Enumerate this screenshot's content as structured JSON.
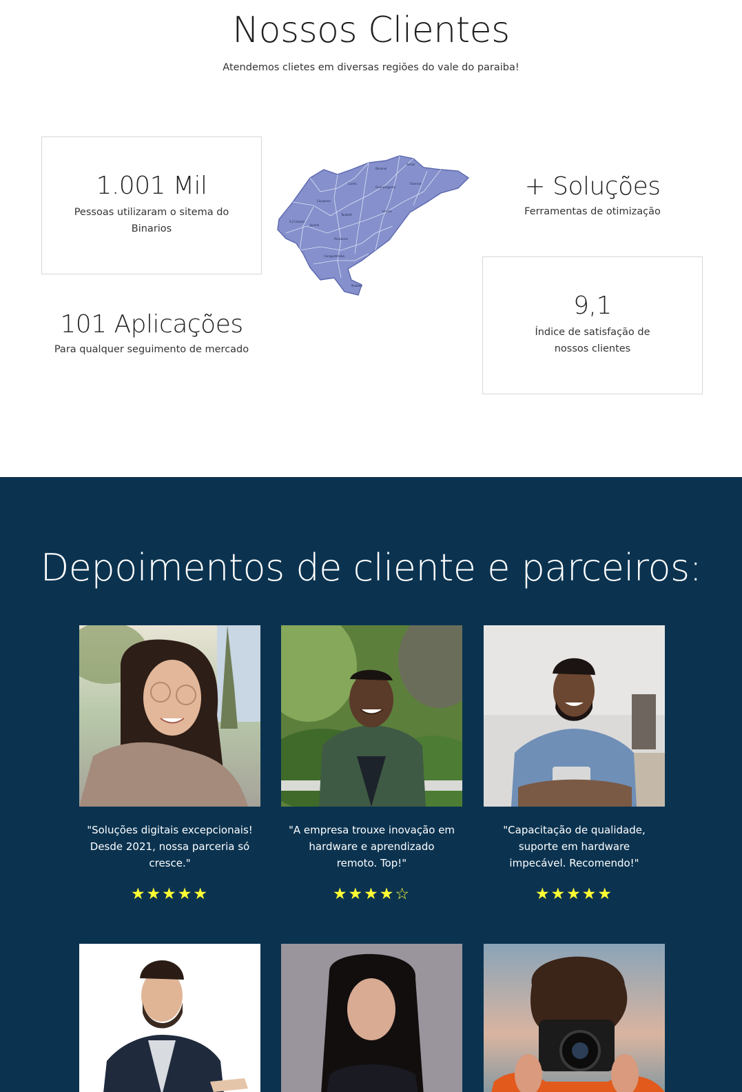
{
  "clients": {
    "title": "Nossos Clientes",
    "subtitle": "Atendemos clietes em diversas regiões do vale do paraiba!",
    "stats": [
      {
        "number": "1.001 Mil",
        "description": "Pessoas utilizaram o sitema do Binarios"
      },
      {
        "number": "101 Aplicações",
        "description": "Para qualquer seguimento de mercado"
      },
      {
        "number": "+ Soluções",
        "description": "Ferramentas de otimização"
      },
      {
        "number": "9,1",
        "description": "Índice de satisfação de nossos clientes"
      }
    ],
    "map_icon": "vale-do-paraiba-map"
  },
  "testimonials": {
    "title": "Depoimentos de cliente e parceiros:",
    "star_color": "#ffff33",
    "background": "#0b3350",
    "items": [
      {
        "quote": "\"Soluções digitais excepcionais! Desde 2021, nossa parceria só cresce.\"",
        "rating": 5,
        "stars": "★★★★★"
      },
      {
        "quote": "\"A empresa trouxe inovação em hardware e aprendizado remoto. Top!\"",
        "rating": 4,
        "stars": "★★★★☆"
      },
      {
        "quote": "\"Capacitação de qualidade, suporte em hardware impecável. Recomendo!\"",
        "rating": 5,
        "stars": "★★★★★"
      },
      {
        "quote": "",
        "rating": null,
        "stars": ""
      },
      {
        "quote": "",
        "rating": null,
        "stars": ""
      },
      {
        "quote": "",
        "rating": null,
        "stars": ""
      }
    ]
  }
}
